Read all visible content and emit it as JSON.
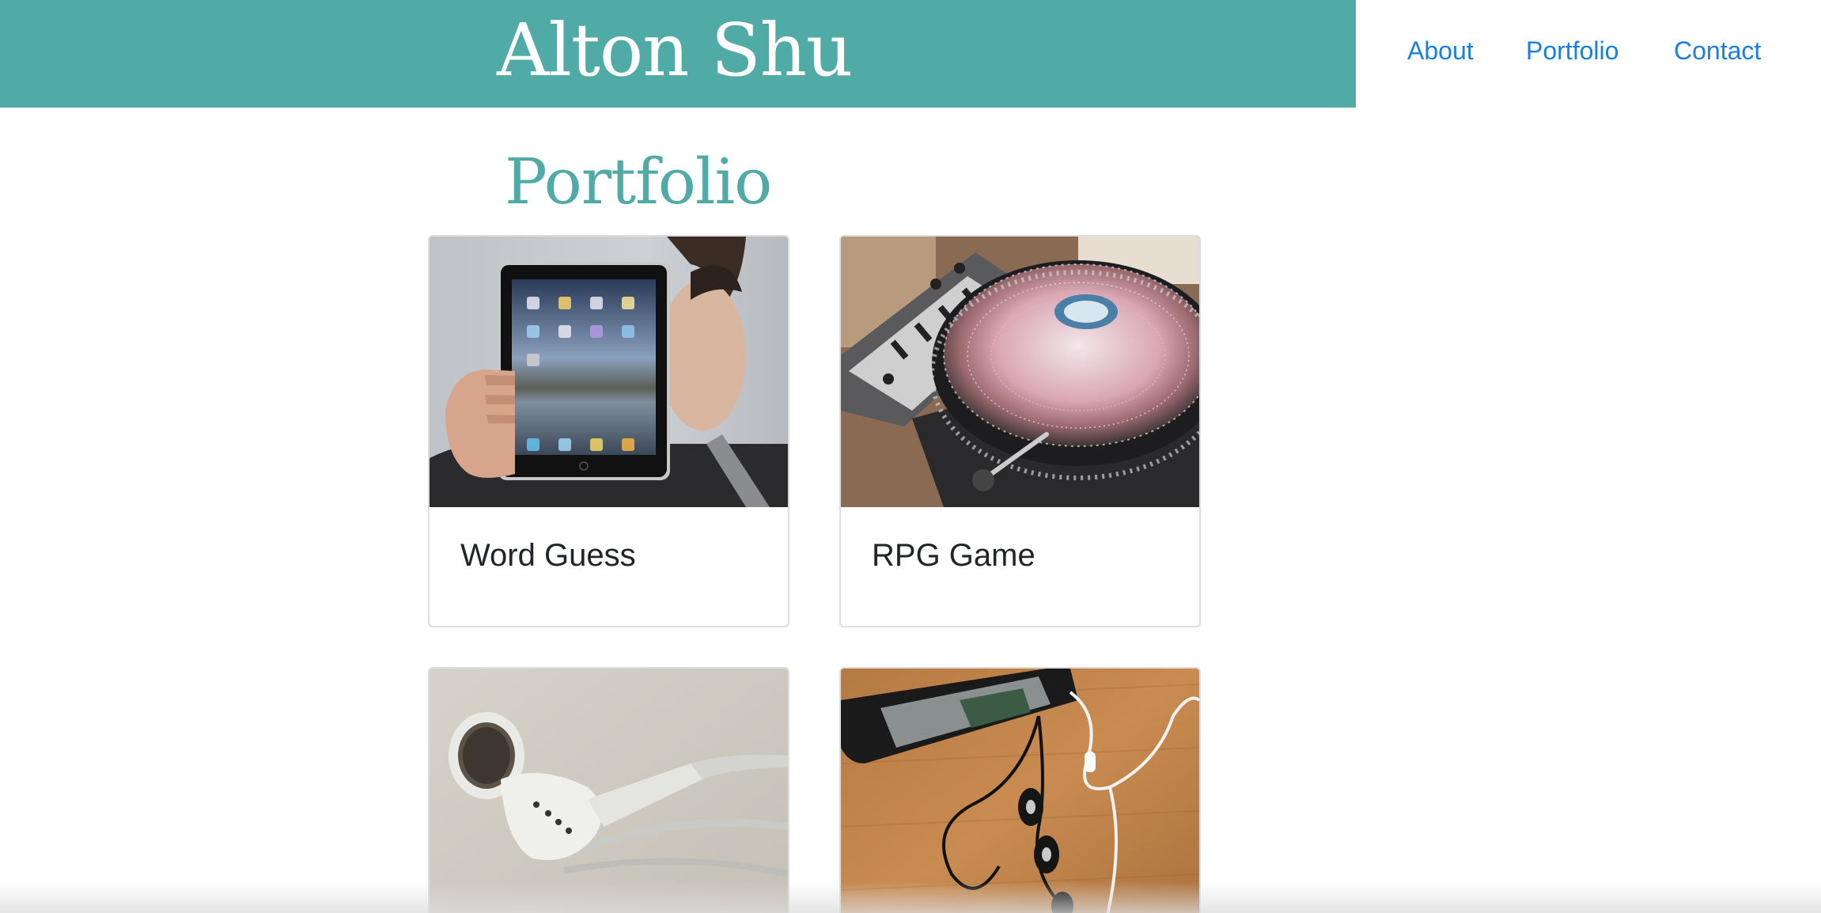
{
  "header": {
    "title": "Alton Shu",
    "nav": [
      {
        "label": "About"
      },
      {
        "label": "Portfolio"
      },
      {
        "label": "Contact"
      }
    ]
  },
  "main": {
    "section_title": "Portfolio",
    "cards": [
      {
        "title": "Word Guess",
        "image": "tablet-photo"
      },
      {
        "title": "RPG Game",
        "image": "turntable-photo"
      },
      {
        "title": "",
        "image": "earbuds-photo"
      },
      {
        "title": "",
        "image": "phone-earphones-photo"
      }
    ]
  },
  "colors": {
    "brand": "#50aaa6",
    "link": "#1b7fe0",
    "heading_text": "#212529"
  }
}
